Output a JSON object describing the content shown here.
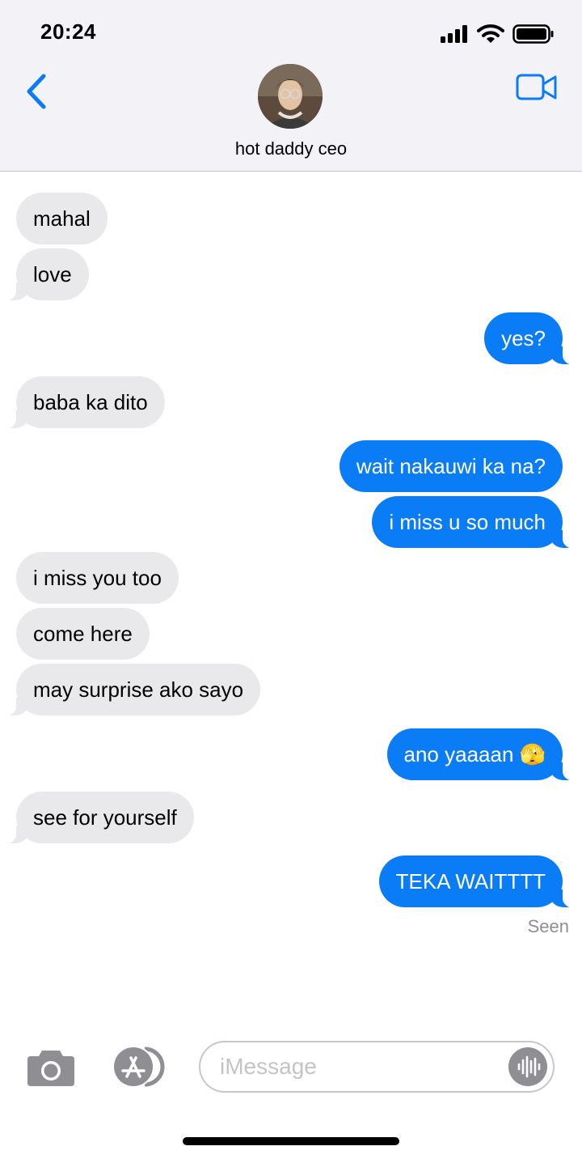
{
  "status_bar": {
    "time": "20:24"
  },
  "header": {
    "contact_name": "hot daddy ceo"
  },
  "messages": [
    {
      "dir": "in",
      "text": "mahal"
    },
    {
      "dir": "in",
      "text": "love"
    },
    {
      "dir": "out",
      "text": "yes?"
    },
    {
      "dir": "in",
      "text": "baba ka dito"
    },
    {
      "dir": "out",
      "text": "wait nakauwi ka na?"
    },
    {
      "dir": "out",
      "text": "i miss u so much"
    },
    {
      "dir": "in",
      "text": "i miss you too"
    },
    {
      "dir": "in",
      "text": "come here"
    },
    {
      "dir": "in",
      "text": "may surprise ako sayo"
    },
    {
      "dir": "out",
      "text": "ano yaaaan 🫣"
    },
    {
      "dir": "in",
      "text": "see for yourself"
    },
    {
      "dir": "out",
      "text": "TEKA WAITTTT"
    }
  ],
  "read_receipt": "Seen",
  "composer": {
    "placeholder": "iMessage"
  },
  "colors": {
    "accent": "#0a7cf5",
    "incoming_bubble": "#e9e9eb",
    "header_bg": "#f2f2f7"
  },
  "icons": [
    "back-chevron-icon",
    "facetime-video-icon",
    "camera-icon",
    "app-store-icon",
    "audio-waveform-icon"
  ]
}
